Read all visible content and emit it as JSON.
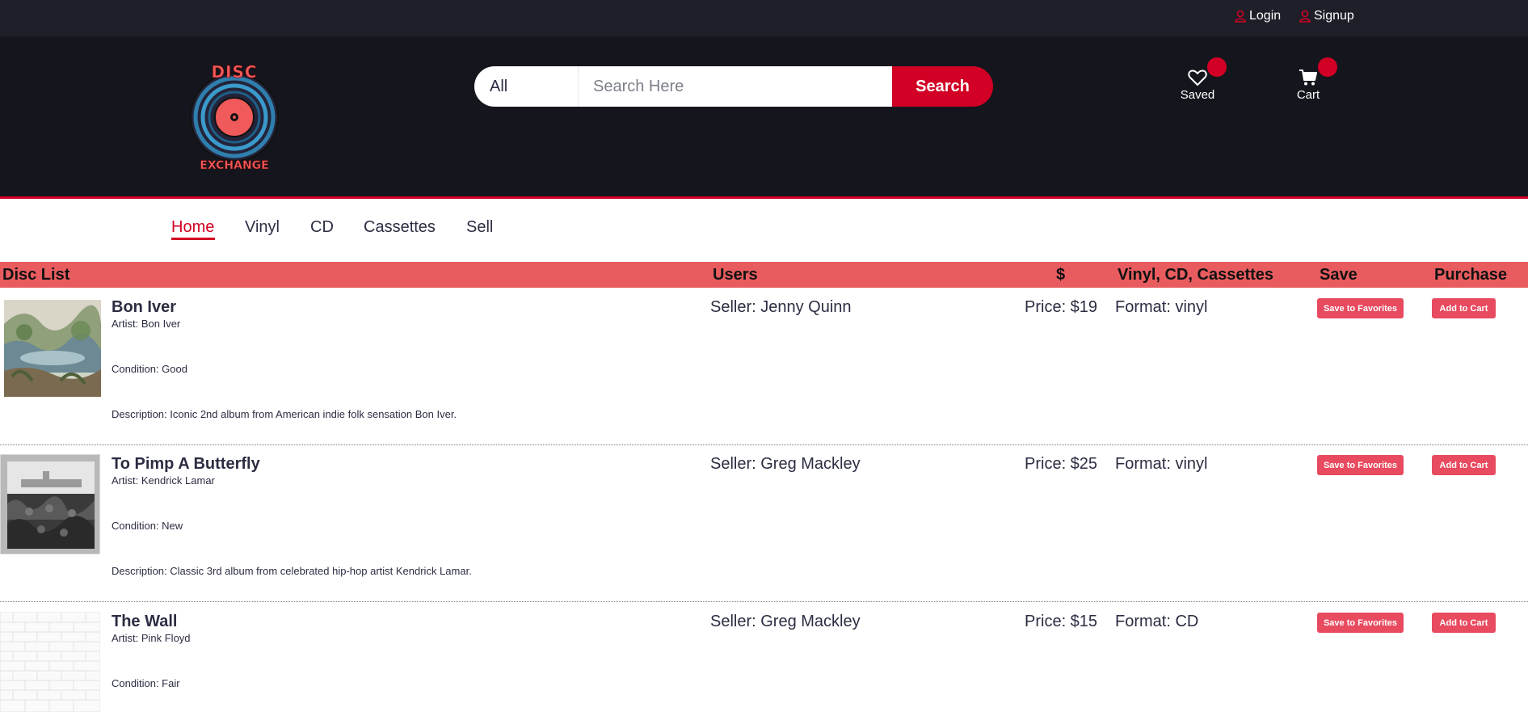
{
  "topbar": {
    "login_label": "Login",
    "signup_label": "Signup"
  },
  "logo": {
    "line1": "DISC",
    "line2": "EXCHANGE"
  },
  "search": {
    "category": "All",
    "placeholder": "Search Here",
    "value": "",
    "button_label": "Search"
  },
  "header": {
    "saved_label": "Saved",
    "cart_label": "Cart"
  },
  "nav": {
    "items": [
      "Home",
      "Vinyl",
      "CD",
      "Cassettes",
      "Sell"
    ],
    "active": "Home"
  },
  "table": {
    "headers": {
      "disc_list": "Disc List",
      "users": "Users",
      "price": "$",
      "format": "Vinyl, CD, Cassettes",
      "save": "Save",
      "purchase": "Purchase"
    },
    "save_button_label": "Save to Favorites",
    "cart_button_label": "Add to Cart",
    "rows": [
      {
        "title": "Bon Iver",
        "artist": "Artist: Bon Iver",
        "condition": "Condition: Good",
        "description": "Description: Iconic 2nd album from American indie folk sensation Bon Iver.",
        "seller": "Seller: Jenny Quinn",
        "price": "Price: $19",
        "format": "Format: vinyl"
      },
      {
        "title": "To Pimp A Butterfly",
        "artist": "Artist: Kendrick Lamar",
        "condition": "Condition: New",
        "description": "Description: Classic 3rd album from celebrated hip-hop artist Kendrick Lamar.",
        "seller": "Seller: Greg Mackley",
        "price": "Price: $25",
        "format": "Format: vinyl"
      },
      {
        "title": "The Wall",
        "artist": "Artist: Pink Floyd",
        "condition": "Condition: Fair",
        "seller": "Seller: Greg Mackley",
        "price": "Price: $15",
        "format": "Format: CD"
      }
    ]
  },
  "colors": {
    "brand_red": "#d10024",
    "header_dark": "#15161d",
    "topbar_dark": "#1e1f29",
    "table_header": "#e85c5f",
    "button_pink": "#e84a5f"
  }
}
